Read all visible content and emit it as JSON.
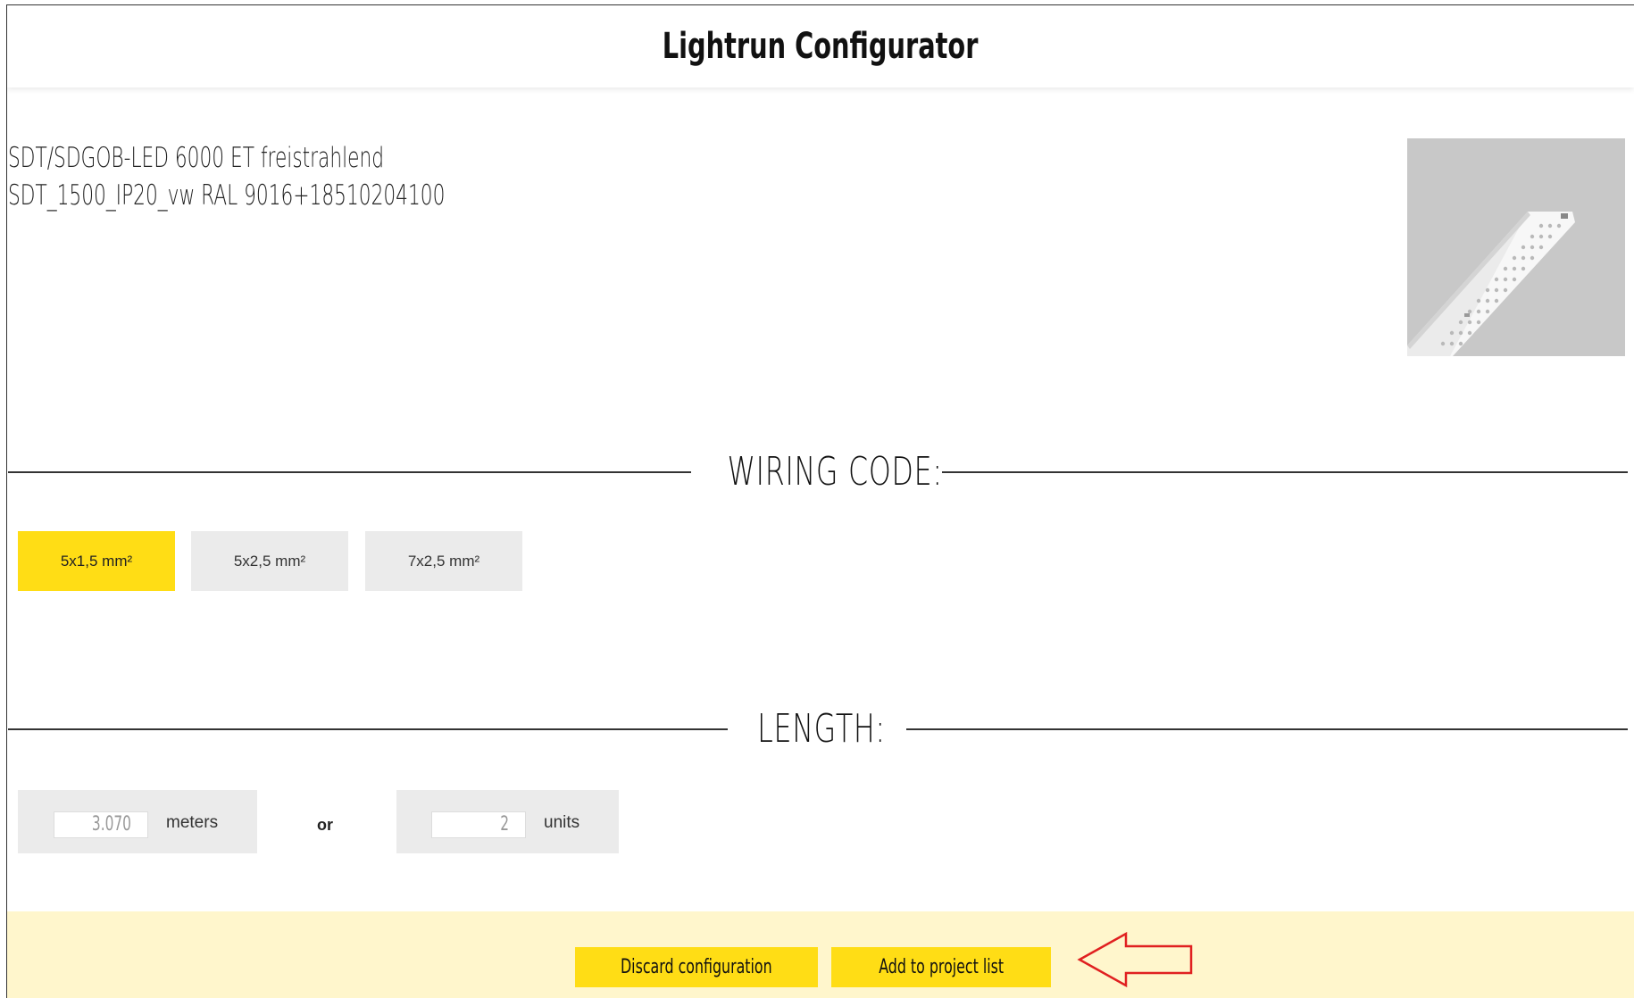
{
  "header": {
    "title": "Lightrun Configurator"
  },
  "product": {
    "line1": "SDT/SDGOB-LED 6000 ET freistrahlend",
    "line2": "SDT_1500_IP20_vw RAL 9016+18510204100",
    "image_icon": "led-luminaire-image"
  },
  "wiring": {
    "title": "WIRING CODE:",
    "options": [
      {
        "label": "5x1,5 mm²",
        "selected": true
      },
      {
        "label": "5x2,5 mm²",
        "selected": false
      },
      {
        "label": "7x2,5 mm²",
        "selected": false
      }
    ]
  },
  "length": {
    "title": "LENGTH:",
    "meters_value": "3.070",
    "meters_label": "meters",
    "or_label": "or",
    "units_value": "2",
    "units_label": "units"
  },
  "footer": {
    "discard_label": "Discard configuration",
    "add_label": "Add to project list",
    "annotation_icon": "left-arrow-icon"
  },
  "colors": {
    "accent": "#ffdd15",
    "footer_bg": "#fff6cc",
    "option_bg": "#ebebeb",
    "annotation": "#e02020"
  }
}
